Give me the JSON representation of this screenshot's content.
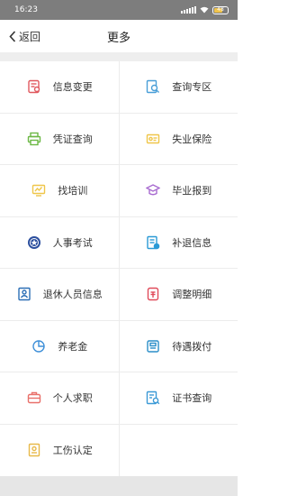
{
  "status_bar": {
    "time": "16:23",
    "battery": "48"
  },
  "nav": {
    "back_label": "返回",
    "title": "更多"
  },
  "items": [
    {
      "label": "信息变更",
      "icon": "profile-edit-icon",
      "color": "#e0585e"
    },
    {
      "label": "查询专区",
      "icon": "search-doc-icon",
      "color": "#4a9fd8"
    },
    {
      "label": "凭证查询",
      "icon": "printer-icon",
      "color": "#6cb845"
    },
    {
      "label": "失业保险",
      "icon": "card-icon",
      "color": "#efc64a"
    },
    {
      "label": "找培训",
      "icon": "training-icon",
      "color": "#efc64a"
    },
    {
      "label": "毕业报到",
      "icon": "graduation-cap-icon",
      "color": "#a86bd0"
    },
    {
      "label": "人事考试",
      "icon": "emblem-icon",
      "color": "#2c4f9e"
    },
    {
      "label": "补退信息",
      "icon": "refund-doc-icon",
      "color": "#2a9ad6"
    },
    {
      "label": "退休人员信息",
      "icon": "retiree-icon",
      "color": "#2c6fb6"
    },
    {
      "label": "调整明细",
      "icon": "adjust-detail-icon",
      "color": "#e04b5a"
    },
    {
      "label": "养老金",
      "icon": "pie-chart-icon",
      "color": "#3d8fd8"
    },
    {
      "label": "待遇拨付",
      "icon": "payment-icon",
      "color": "#2a8ec8"
    },
    {
      "label": "个人求职",
      "icon": "briefcase-icon",
      "color": "#e9706a"
    },
    {
      "label": "证书查询",
      "icon": "certificate-icon",
      "color": "#3c9ad6"
    },
    {
      "label": "工伤认定",
      "icon": "injury-doc-icon",
      "color": "#e8b94a"
    }
  ]
}
